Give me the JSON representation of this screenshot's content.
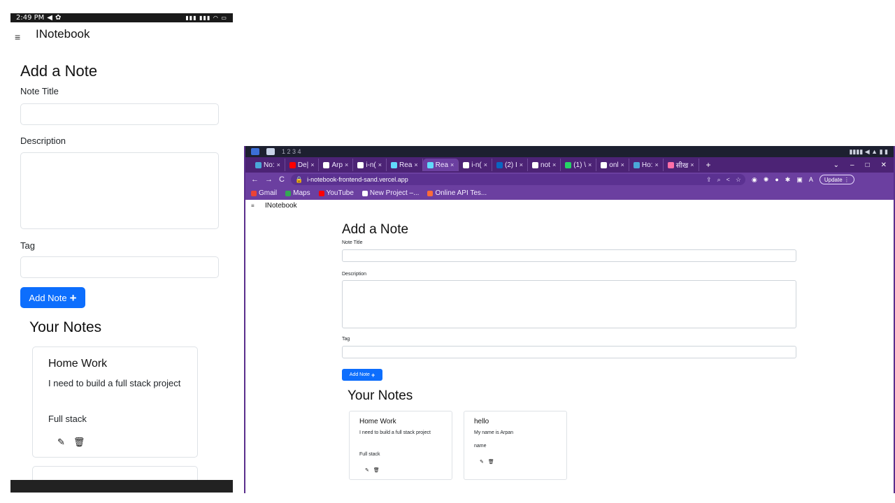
{
  "phone": {
    "status_time": "2:49 PM",
    "brand": "INotebook",
    "heading": "Add a Note",
    "title_label": "Note Title",
    "desc_label": "Description",
    "tag_label": "Tag",
    "add_button": "Add Note",
    "notes_heading": "Your Notes",
    "note": {
      "title": "Home Work",
      "description": "I need to build a full stack project",
      "tag": "Full stack"
    }
  },
  "desktop": {
    "tabs": [
      {
        "label": "No:",
        "color": "#4aa7d8"
      },
      {
        "label": "De|",
        "color": "#ff0000"
      },
      {
        "label": "Arp",
        "color": "#ffffff"
      },
      {
        "label": "i-n(",
        "color": "#ffffff"
      },
      {
        "label": "Rea",
        "color": "#61dafb"
      },
      {
        "label": "Rea",
        "color": "#61dafb"
      },
      {
        "label": "i-n(",
        "color": "#ffffff"
      },
      {
        "label": "(2) I",
        "color": "#0a66c2"
      },
      {
        "label": "not",
        "color": "#ffffff"
      },
      {
        "label": "(1) \\",
        "color": "#25d366"
      },
      {
        "label": "onl",
        "color": "#ffffff"
      },
      {
        "label": "Ho:",
        "color": "#4aa7d8"
      },
      {
        "label": "सीख",
        "color": "#ff6fa8"
      }
    ],
    "url": "i-notebook-frontend-sand.vercel.app",
    "update_label": "Update",
    "profile_letter": "A",
    "bookmarks": [
      {
        "label": "Gmail",
        "color": "#ea4335"
      },
      {
        "label": "Maps",
        "color": "#34a853"
      },
      {
        "label": "YouTube",
        "color": "#ff0000"
      },
      {
        "label": "New Project –...",
        "color": "#ffffff"
      },
      {
        "label": "Online API Tes...",
        "color": "#ff6c37"
      }
    ],
    "brand": "INotebook",
    "heading": "Add a Note",
    "title_label": "Note Title",
    "desc_label": "Description",
    "tag_label": "Tag",
    "add_button": "Add Note",
    "notes_heading": "Your Notes",
    "notes": [
      {
        "title": "Home Work",
        "description": "I need to build a full stack project",
        "tag": "Full stack"
      },
      {
        "title": "hello",
        "description": "My name is Arpan",
        "tag": "name"
      }
    ]
  },
  "colors": {
    "primary": "#0d6efd",
    "browser_purple": "#6b3fa0",
    "tab_strip": "#4c2375"
  }
}
